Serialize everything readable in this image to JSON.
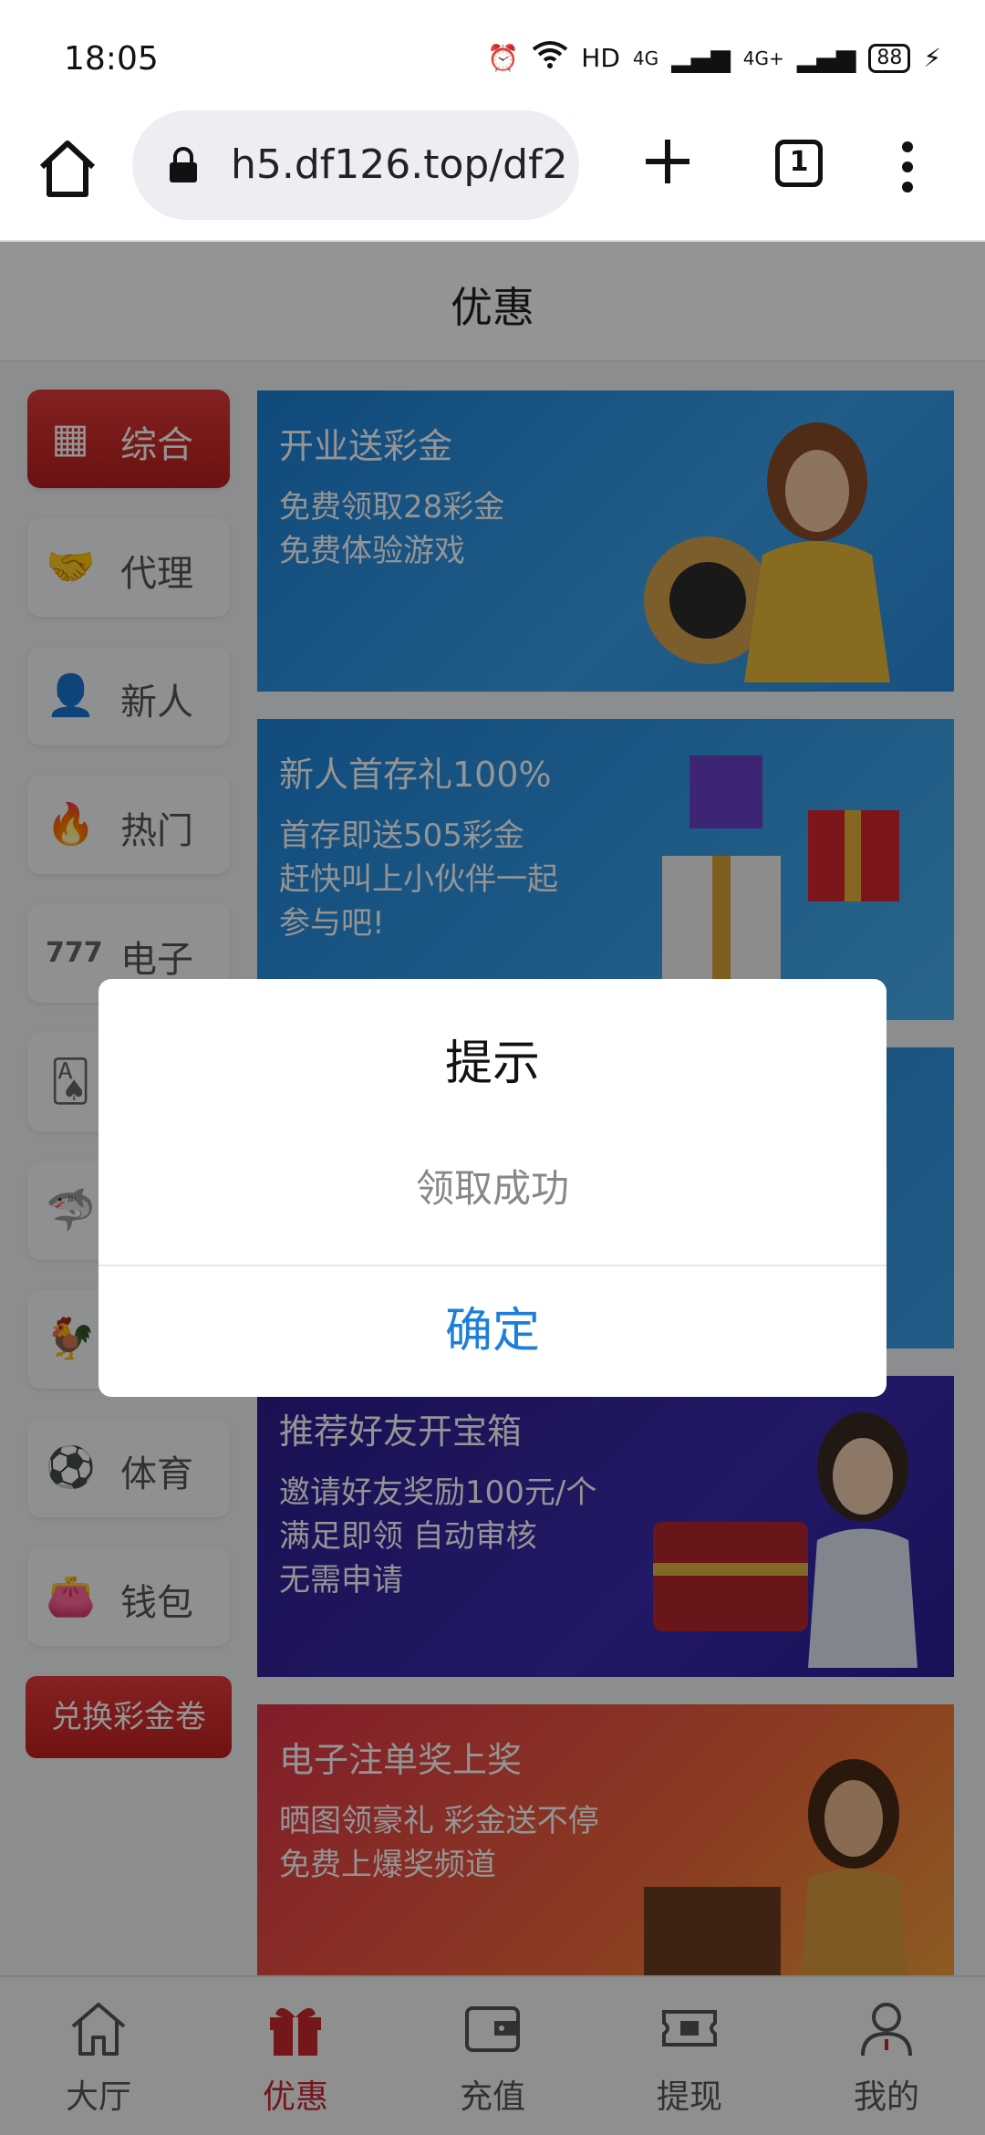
{
  "status_bar": {
    "time": "18:05",
    "network": "HD",
    "signal1": "4G",
    "signal2": "4G+",
    "battery": "88"
  },
  "browser": {
    "url": "h5.df126.top/df2",
    "tab_count": "1"
  },
  "page": {
    "title": "优惠"
  },
  "sidebar": {
    "items": [
      {
        "label": "综合",
        "icon": "grid-icon",
        "active": true
      },
      {
        "label": "代理",
        "icon": "handshake-icon",
        "active": false
      },
      {
        "label": "新人",
        "icon": "person-icon",
        "active": false
      },
      {
        "label": "热门",
        "icon": "flame-icon",
        "active": false
      },
      {
        "label": "电子",
        "icon": "slot-777-icon",
        "active": false
      },
      {
        "label": "",
        "icon": "cards-icon",
        "active": false
      },
      {
        "label": "",
        "icon": "fish-icon",
        "active": false
      },
      {
        "label": "",
        "icon": "animal-icon",
        "active": false
      },
      {
        "label": "体育",
        "icon": "soccer-ball-icon",
        "active": false
      },
      {
        "label": "钱包",
        "icon": "wallet-icon",
        "active": false
      }
    ],
    "redeem_label": "兑换彩金卷"
  },
  "banners": [
    {
      "title": "开业送彩金",
      "lines": [
        "免费领取28彩金",
        "免费体验游戏"
      ]
    },
    {
      "title": "新人首存礼100%",
      "lines": [
        "首存即送505彩金",
        "赶快叫上小伙伴一起",
        "参与吧!"
      ]
    },
    {
      "title": "",
      "lines": []
    },
    {
      "title": "推荐好友开宝箱",
      "lines": [
        "邀请好友奖励100元/个",
        "满足即领 自动审核",
        "无需申请"
      ]
    },
    {
      "title": "电子注单奖上奖",
      "lines": [
        "晒图领豪礼 彩金送不停",
        "免费上爆奖频道"
      ]
    }
  ],
  "bottom_nav": [
    {
      "label": "大厅",
      "icon": "home-icon",
      "active": false
    },
    {
      "label": "优惠",
      "icon": "gift-icon",
      "active": true
    },
    {
      "label": "充值",
      "icon": "deposit-wallet-icon",
      "active": false
    },
    {
      "label": "提现",
      "icon": "withdraw-ticket-icon",
      "active": false
    },
    {
      "label": "我的",
      "icon": "profile-icon",
      "active": false
    }
  ],
  "dialog": {
    "title": "提示",
    "message": "领取成功",
    "confirm_label": "确定"
  },
  "colors": {
    "brand_red": "#c8262d",
    "dialog_button_blue": "#1e7fd8"
  }
}
